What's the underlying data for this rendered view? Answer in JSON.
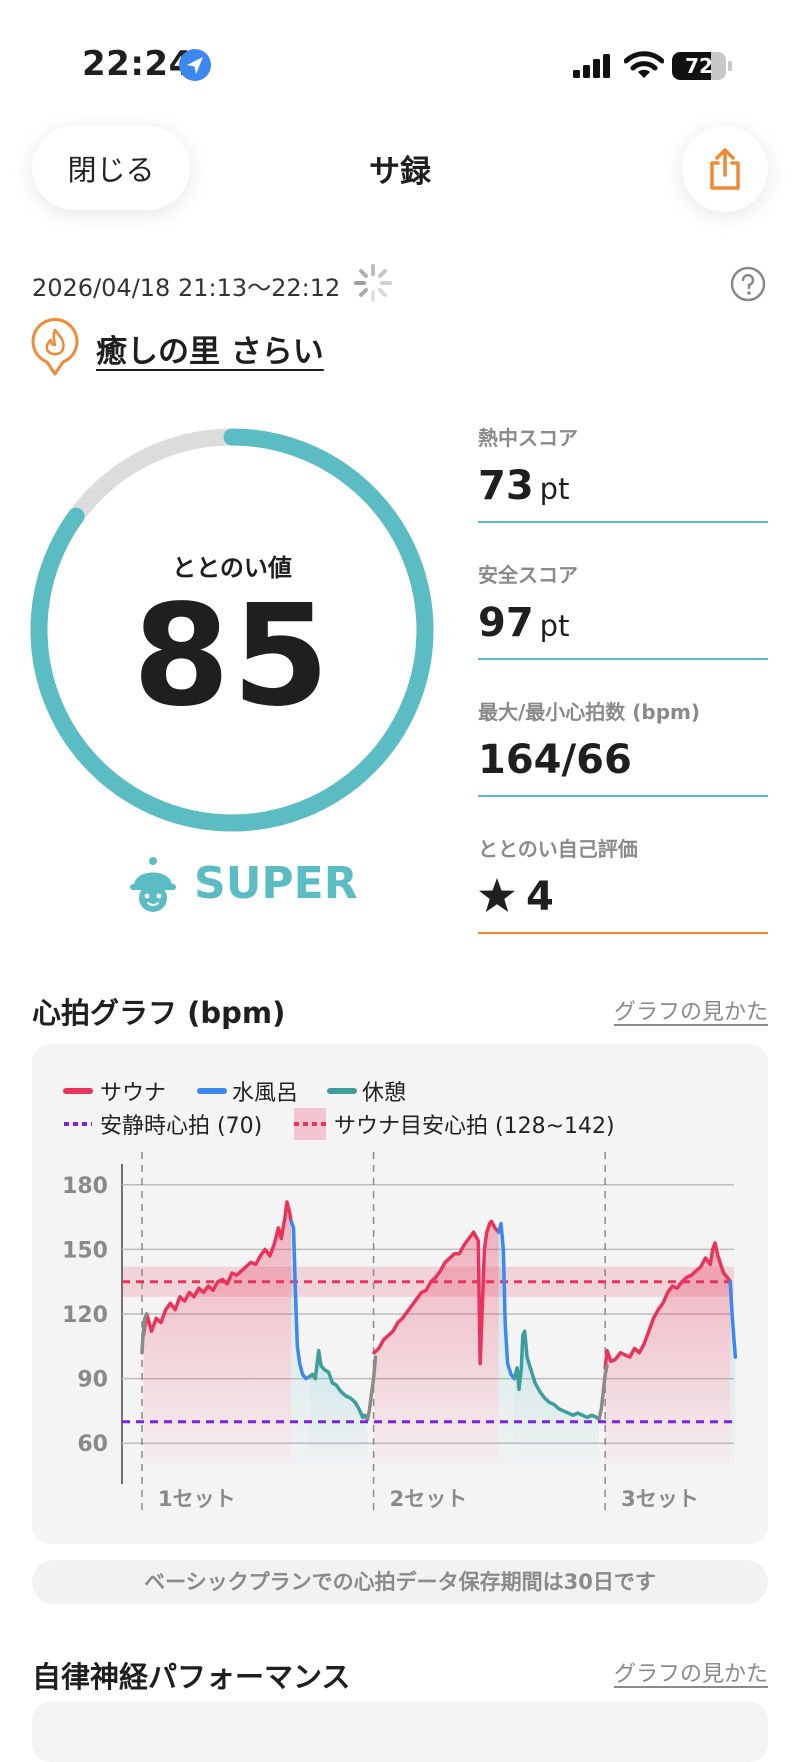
{
  "status_bar": {
    "time": "22:24",
    "battery": "72",
    "battery_level": 0.72
  },
  "header": {
    "close_label": "閉じる",
    "title": "サ録"
  },
  "session": {
    "datetime": "2026/04/18 21:13～22:12",
    "facility": "癒しの里 さらい"
  },
  "score": {
    "label": "ととのい値",
    "value": "85",
    "progress": 0.85,
    "rank": "SUPER"
  },
  "metrics": [
    {
      "label": "熱中スコア",
      "value": "73",
      "unit": "pt"
    },
    {
      "label": "安全スコア",
      "value": "97",
      "unit": "pt"
    },
    {
      "label": "最大/最小心拍数 (bpm)",
      "value": "164/66",
      "unit": ""
    },
    {
      "label": "ととのい自己評価",
      "value": "4",
      "unit": ""
    }
  ],
  "heart_section": {
    "title": "心拍グラフ (bpm)",
    "guide_link": "グラフの見かた"
  },
  "colors": {
    "accent": "#5bbcc4",
    "orange": "#ef8a35",
    "sauna": "#e8345a",
    "water": "#3d87f0",
    "rest": "#3e9e9c",
    "resting": "#7b22e6",
    "gray": "#8a8a8a"
  },
  "chart_data": {
    "type": "line",
    "title": "心拍グラフ (bpm)",
    "ylabel": "",
    "ylim": [
      55,
      185
    ],
    "yticks": [
      180,
      150,
      120,
      90,
      60
    ],
    "legend": [
      "サウナ",
      "水風呂",
      "休憩",
      "安静時心拍 (70)",
      "サウナ目安心拍 (128~142)"
    ],
    "set_labels": [
      "1セット",
      "2セット",
      "3セット"
    ],
    "resting_hr": 70,
    "target_band": [
      128,
      142
    ],
    "target_line": 135,
    "set_starts": [
      0,
      48.9,
      97.8
    ],
    "x_end": 125,
    "series": [
      {
        "name": "サウナ",
        "color": "#e8345a",
        "segments": [
          [
            [
              0.3,
              110
            ],
            [
              1,
              120
            ],
            [
              2,
              112
            ],
            [
              3,
              118
            ],
            [
              4,
              116
            ],
            [
              5,
              122
            ],
            [
              6,
              125
            ],
            [
              7,
              122
            ],
            [
              8,
              128
            ],
            [
              9,
              126
            ],
            [
              10,
              130
            ],
            [
              11,
              128
            ],
            [
              12,
              132
            ],
            [
              13,
              130
            ],
            [
              14,
              133
            ],
            [
              15,
              131
            ],
            [
              16,
              135
            ],
            [
              17,
              136
            ],
            [
              18,
              134
            ],
            [
              19,
              139
            ],
            [
              20,
              138
            ],
            [
              21,
              140
            ],
            [
              22,
              142
            ],
            [
              23,
              144
            ],
            [
              24,
              143
            ],
            [
              25,
              147
            ],
            [
              26,
              150
            ],
            [
              27,
              147
            ],
            [
              28,
              153
            ],
            [
              28.8,
              160
            ],
            [
              29.4,
              155
            ],
            [
              30.2,
              165
            ],
            [
              30.6,
              172
            ],
            [
              31.1,
              168
            ],
            [
              31.5,
              163
            ]
          ],
          [
            [
              49,
              102
            ],
            [
              50,
              104
            ],
            [
              51,
              108
            ],
            [
              52,
              110
            ],
            [
              53,
              112
            ],
            [
              54,
              116
            ],
            [
              55,
              118
            ],
            [
              56,
              121
            ],
            [
              57,
              124
            ],
            [
              58,
              127
            ],
            [
              59,
              130
            ],
            [
              60,
              131
            ],
            [
              61,
              135
            ],
            [
              62,
              137
            ],
            [
              63,
              140
            ],
            [
              64,
              144
            ],
            [
              65,
              146
            ],
            [
              66,
              148
            ],
            [
              67,
              148
            ],
            [
              68,
              152
            ],
            [
              69,
              155
            ],
            [
              70,
              158
            ],
            [
              71,
              154
            ],
            [
              71.4,
              97
            ],
            [
              71.8,
              120
            ],
            [
              72.3,
              150
            ],
            [
              72.8,
              158
            ],
            [
              73.4,
              162
            ],
            [
              73.8,
              163
            ],
            [
              74.5,
              160
            ],
            [
              75.3,
              158
            ]
          ],
          [
            [
              97.8,
              95
            ],
            [
              98.2,
              103
            ],
            [
              99,
              98
            ],
            [
              100,
              99
            ],
            [
              101,
              102
            ],
            [
              102,
              101
            ],
            [
              103,
              100
            ],
            [
              104,
              104
            ],
            [
              105,
              102
            ],
            [
              106,
              106
            ],
            [
              107,
              112
            ],
            [
              108,
              118
            ],
            [
              109,
              122
            ],
            [
              110,
              125
            ],
            [
              111,
              130
            ],
            [
              112,
              133
            ],
            [
              113,
              132
            ],
            [
              114,
              135
            ],
            [
              115,
              137
            ],
            [
              116,
              138
            ],
            [
              117,
              140
            ],
            [
              118,
              142
            ],
            [
              119,
              146
            ],
            [
              120,
              143
            ],
            [
              120.5,
              150
            ],
            [
              121,
              153
            ],
            [
              121.6,
              147
            ],
            [
              122.2,
              143
            ],
            [
              122.8,
              139
            ],
            [
              123.6,
              137
            ],
            [
              124.2,
              135
            ]
          ]
        ]
      },
      {
        "name": "水風呂",
        "color": "#3d87f0",
        "segments": [
          [
            [
              31.5,
              163
            ],
            [
              32,
              160
            ],
            [
              32.4,
              130
            ],
            [
              32.8,
              105
            ],
            [
              33.3,
              97
            ],
            [
              33.9,
              92
            ],
            [
              34.6,
              90
            ],
            [
              35.4,
              91
            ]
          ],
          [
            [
              75.3,
              158
            ],
            [
              75.8,
              162
            ],
            [
              76.3,
              150
            ],
            [
              76.7,
              115
            ],
            [
              77.2,
              97
            ],
            [
              77.9,
              92
            ],
            [
              78.6,
              90
            ]
          ],
          [
            [
              124.2,
              135
            ],
            [
              124.6,
              120
            ],
            [
              125,
              108
            ],
            [
              125.3,
              100
            ]
          ]
        ]
      },
      {
        "name": "休憩",
        "color": "#3e9e9c",
        "segments": [
          [
            [
              35.4,
              91
            ],
            [
              36,
              92
            ],
            [
              36.6,
              90
            ],
            [
              37.3,
              103
            ],
            [
              37.8,
              96
            ],
            [
              38.6,
              94
            ],
            [
              39.4,
              93
            ],
            [
              40.2,
              88
            ],
            [
              41,
              87
            ],
            [
              42,
              84
            ],
            [
              43,
              82
            ],
            [
              44,
              81
            ],
            [
              45,
              79
            ],
            [
              45.8,
              76
            ],
            [
              46.6,
              72
            ],
            [
              47,
              73
            ],
            [
              47.6,
              71
            ]
          ],
          [
            [
              78.6,
              90
            ],
            [
              79.2,
              95
            ],
            [
              79.6,
              85
            ],
            [
              80.1,
              95
            ],
            [
              80.4,
              110
            ],
            [
              80.8,
              112
            ],
            [
              81.3,
              100
            ],
            [
              82,
              95
            ],
            [
              83,
              88
            ],
            [
              84,
              84
            ],
            [
              85,
              81
            ],
            [
              86,
              79
            ],
            [
              87,
              78
            ],
            [
              88,
              76
            ],
            [
              89,
              75
            ],
            [
              90,
              74
            ],
            [
              91,
              73
            ],
            [
              92,
              74
            ],
            [
              93,
              73
            ],
            [
              94,
              72
            ],
            [
              95,
              73
            ],
            [
              96,
              72
            ],
            [
              96.5,
              71
            ]
          ]
        ]
      },
      {
        "name": "other",
        "color": "#8a8a8a",
        "segments": [
          [
            [
              0,
              102
            ],
            [
              0.2,
              110
            ],
            [
              0.6,
              118
            ],
            [
              1,
              120
            ]
          ],
          [
            [
              47.6,
              71
            ],
            [
              48,
              75
            ],
            [
              48.4,
              82
            ],
            [
              48.9,
              90
            ],
            [
              49.3,
              100
            ]
          ],
          [
            [
              96.5,
              71
            ],
            [
              97,
              76
            ],
            [
              97.4,
              84
            ],
            [
              97.8,
              92
            ],
            [
              98.2,
              96
            ]
          ]
        ]
      }
    ]
  },
  "notice": "ベーシックプランでの心拍データ保存期間は30日です",
  "autonomic_section": {
    "title": "自律神経パフォーマンス",
    "guide_link": "グラフの見かた"
  }
}
